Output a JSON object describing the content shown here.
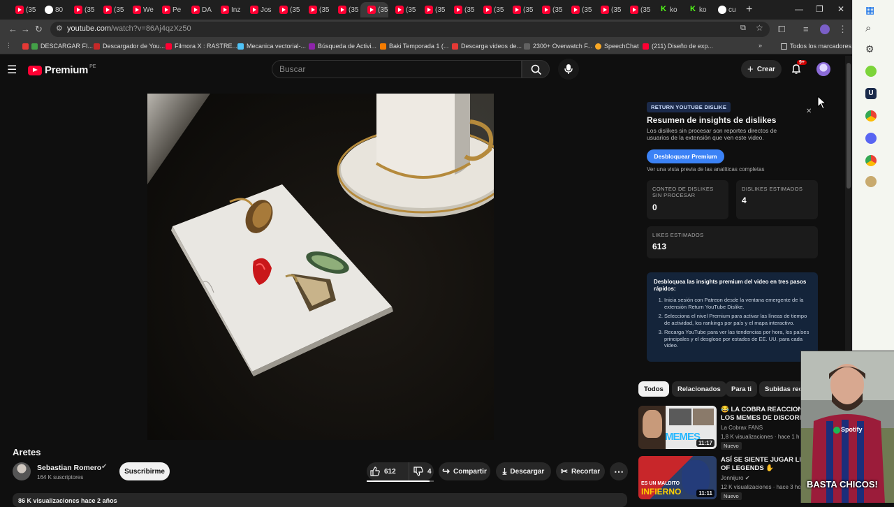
{
  "browser": {
    "tabs": [
      "(35",
      "80",
      "(35",
      "(35",
      "We",
      "Pe",
      "DA",
      "Inz",
      "Jos",
      "(35",
      "(35",
      "(35",
      "(35",
      "(35",
      "(35",
      "(35",
      "(35",
      "(35",
      "(35",
      "(35",
      "(35",
      "(35",
      "ko",
      "ko",
      "cu"
    ],
    "active_tab_index": 12,
    "url_host": "youtube.com",
    "url_path": "/watch?v=86Aj4qzXz50",
    "bookmarks": [
      "DESCARGAR FI...",
      "Descargador de You...",
      "Filmora X : RASTRE...",
      "Mecanica vectorial-...",
      "Búsqueda de Activi...",
      "Baki Temporada 1 (...",
      "Descarga videos de...",
      "2300+ Overwatch F...",
      "SpeechChat",
      "(211) Diseño de exp..."
    ],
    "all_bookmarks_label": "Todos los marcadores"
  },
  "youtube": {
    "logo_text": "Premium",
    "logo_country": "PE",
    "search_placeholder": "Buscar",
    "create_label": "Crear",
    "notif_badge": "9+",
    "video_title": "Aretes",
    "channel_name": "Sebastian Romero",
    "subscribers": "164 K suscriptores",
    "subscribe_label": "Suscribirme",
    "likes": "612",
    "dislikes": "4",
    "share_label": "Compartir",
    "download_label": "Descargar",
    "clip_label": "Recortar",
    "views_partial": "86 K visualizaciones  hace 2 años"
  },
  "ryd": {
    "tag": "RETURN YOUTUBE DISLIKE",
    "title": "Resumen de insights de dislikes",
    "desc": "Los dislikes sin procesar son reportes directos de usuarios de la extensión que ven este video.",
    "unlock_label": "Desbloquear Premium",
    "preview_text": "Ver una vista previa de las analíticas completas",
    "raw_label_1": "CONTEO DE DISLIKES",
    "raw_label_2": "SIN PROCESAR",
    "raw_value": "0",
    "est_dislikes_label": "DISLIKES ESTIMADOS",
    "est_dislikes_value": "4",
    "est_likes_label": "LIKES ESTIMADOS",
    "est_likes_value": "613",
    "steps_heading": "Desbloquea las insights premium del video en tres pasos rápidos:",
    "steps": [
      "Inicia sesión con Patreon desde la ventana emergente de la extensión Return YouTube Dislike.",
      "Selecciona el nivel Premium para activar las líneas de tiempo de actividad, los rankings por país y el mapa interactivo.",
      "Recarga YouTube para ver las tendencias por hora, los países principales y el desglose por estados de EE. UU. para cada video."
    ]
  },
  "chips": [
    "Todos",
    "Relacionados",
    "Para ti",
    "Subidas rec"
  ],
  "recommendations": [
    {
      "title1": "😂 LA COBRA REACCIONA",
      "title2": "LOS MEMES DE DISCORD.",
      "channel": "La Cobrax FANS",
      "meta": "1,8 K visualizaciones · hace 1 h",
      "badge": "Nuevo",
      "duration": "11:17",
      "thumb_text": "MEMES"
    },
    {
      "title1": "ASÍ SE SIENTE JUGAR LEA",
      "title2": "OF LEGENDS ✋",
      "channel": "Jonnijuro",
      "meta": "12 K visualizaciones · hace 3 ho",
      "badge": "Nuevo",
      "duration": "11:11",
      "thumb_text_1": "ES UN MALDITO",
      "thumb_text_2": "INFIERNO"
    }
  ],
  "webcam": {
    "caption": "BASTA CHICOS!",
    "shirt_text": "Spotify"
  }
}
